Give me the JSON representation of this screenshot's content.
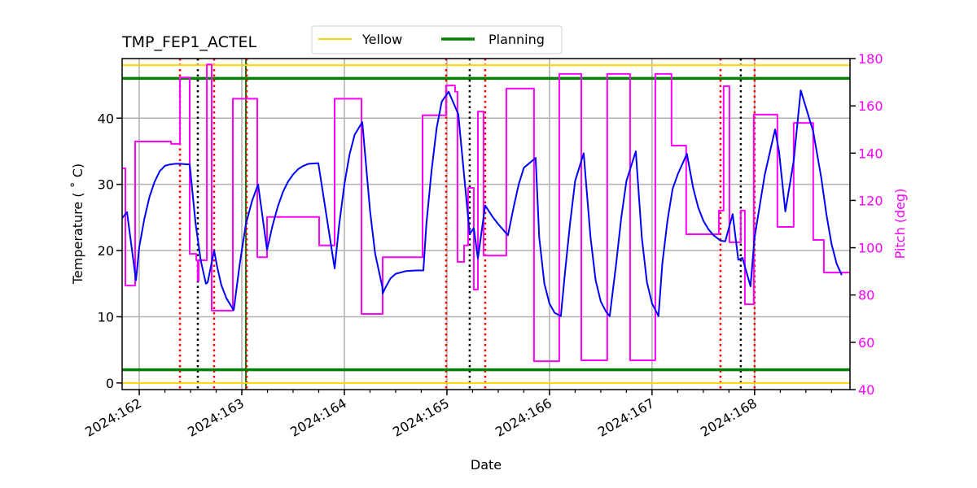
{
  "chart_data": {
    "type": "line",
    "title": "TMP_FEP1_ACTEL",
    "xlabel": "Date",
    "ylabel": "Temperature ($^\\circ$C)",
    "ylabel_display": "Temperature ( ˚ C)",
    "y2label": "Pitch (deg)",
    "xlim": [
      161.833,
      168.93
    ],
    "ylim": [
      -1,
      49
    ],
    "y2lim": [
      40,
      180
    ],
    "x_ticks": [
      {
        "value": 162,
        "label": "2024:162"
      },
      {
        "value": 163,
        "label": "2024:163"
      },
      {
        "value": 164,
        "label": "2024:164"
      },
      {
        "value": 165,
        "label": "2024:165"
      },
      {
        "value": 166,
        "label": "2024:166"
      },
      {
        "value": 167,
        "label": "2024:167"
      },
      {
        "value": 168,
        "label": "2024:168"
      }
    ],
    "x_minor_step": 0.25,
    "y_ticks": [
      0,
      10,
      20,
      30,
      40
    ],
    "y2_ticks": [
      40,
      60,
      80,
      100,
      120,
      140,
      160,
      180
    ],
    "grid": true,
    "legend": {
      "placement": "top-center",
      "entries": [
        {
          "label": "Yellow",
          "color": "#ffd700"
        },
        {
          "label": "Planning",
          "color": "#008000"
        }
      ]
    },
    "limits": {
      "yellow": [
        0,
        48
      ],
      "planning": [
        2,
        46
      ]
    },
    "vlines": {
      "red_dotted": [
        162.397,
        162.73,
        163.048,
        164.992,
        165.373,
        167.667,
        168.0
      ],
      "black_dotted": [
        162.571,
        165.222,
        167.865
      ],
      "green_solid": [
        163.04
      ]
    },
    "series": [
      {
        "name": "Temperature",
        "axis": "left",
        "color": "#0000ff",
        "x": [
          161.833,
          161.881,
          161.968,
          162.0,
          162.05,
          162.1,
          162.15,
          162.2,
          162.25,
          162.3,
          162.35,
          162.397,
          162.492,
          162.55,
          162.6,
          162.65,
          162.667,
          162.73,
          162.76,
          162.8,
          162.85,
          162.92,
          162.921,
          162.98,
          163.04,
          163.1,
          163.159,
          163.246,
          163.3,
          163.35,
          163.4,
          163.45,
          163.5,
          163.55,
          163.6,
          163.65,
          163.746,
          163.905,
          163.95,
          164.0,
          164.05,
          164.1,
          164.175,
          164.25,
          164.3,
          164.37,
          164.373,
          164.4,
          164.45,
          164.5,
          164.6,
          164.7,
          164.77,
          164.8,
          164.85,
          164.9,
          164.95,
          165.016,
          165.111,
          165.222,
          165.262,
          165.302,
          165.373,
          165.45,
          165.5,
          165.595,
          165.65,
          165.7,
          165.75,
          165.865,
          165.9,
          165.95,
          166.0,
          166.05,
          166.111,
          166.15,
          166.2,
          166.25,
          166.333,
          166.4,
          166.45,
          166.5,
          166.55,
          166.587,
          166.65,
          166.7,
          166.75,
          166.841,
          166.9,
          166.95,
          167.0,
          167.05,
          167.063,
          167.1,
          167.15,
          167.2,
          167.25,
          167.34,
          167.4,
          167.45,
          167.5,
          167.55,
          167.6,
          167.65,
          167.667,
          167.714,
          167.786,
          167.841,
          167.881,
          167.96,
          168.0,
          168.1,
          168.2,
          168.238,
          168.3,
          168.381,
          168.45,
          168.571,
          168.65,
          168.7,
          168.75,
          168.8,
          168.85,
          168.93
        ],
        "y": [
          24.9,
          25.8,
          15.5,
          20.5,
          24.8,
          28.1,
          30.4,
          32.0,
          32.8,
          33.0,
          33.1,
          33.1,
          33.0,
          24.0,
          18.5,
          15.0,
          15.2,
          20.0,
          17.5,
          14.8,
          12.8,
          11.0,
          11.0,
          18.0,
          24.0,
          27.5,
          30.0,
          20.1,
          23.8,
          26.6,
          28.8,
          30.4,
          31.5,
          32.3,
          32.8,
          33.1,
          33.2,
          17.3,
          24.0,
          30.0,
          34.5,
          37.5,
          39.4,
          26.0,
          19.5,
          14.5,
          13.5,
          14.4,
          15.8,
          16.5,
          16.9,
          17.0,
          17.0,
          24.0,
          32.0,
          38.5,
          42.5,
          44.0,
          40.6,
          22.5,
          23.4,
          18.8,
          26.8,
          25.0,
          24.0,
          22.3,
          26.5,
          30.0,
          32.5,
          34.0,
          22.0,
          15.0,
          12.0,
          10.6,
          10.1,
          16.5,
          24.0,
          30.5,
          34.7,
          22.0,
          15.5,
          12.3,
          10.8,
          10.1,
          18.0,
          25.0,
          30.5,
          35.0,
          22.0,
          15.2,
          12.0,
          10.5,
          10.1,
          18.0,
          24.5,
          29.3,
          31.5,
          34.6,
          29.5,
          26.5,
          24.5,
          23.2,
          22.3,
          21.7,
          21.5,
          21.4,
          25.5,
          18.6,
          18.9,
          14.6,
          22.0,
          31.5,
          38.3,
          35.0,
          25.9,
          33.5,
          44.2,
          38.0,
          31.0,
          25.5,
          21.0,
          18.0,
          16.3
        ]
      },
      {
        "name": "Pitch",
        "axis": "right",
        "color": "#ff00ff",
        "x": [
          161.833,
          161.865,
          161.865,
          161.96,
          161.96,
          162.31,
          162.31,
          162.397,
          162.397,
          162.492,
          162.492,
          162.556,
          162.556,
          162.57,
          162.57,
          162.579,
          162.579,
          162.659,
          162.659,
          162.706,
          162.706,
          162.913,
          162.913,
          163.151,
          163.151,
          163.246,
          163.246,
          163.754,
          163.754,
          163.905,
          163.905,
          164.167,
          164.167,
          164.373,
          164.373,
          164.762,
          164.762,
          164.992,
          164.992,
          165.079,
          165.079,
          165.103,
          165.103,
          165.167,
          165.167,
          165.206,
          165.206,
          165.262,
          165.262,
          165.302,
          165.302,
          165.357,
          165.357,
          165.579,
          165.579,
          165.849,
          165.849,
          166.095,
          166.095,
          166.31,
          166.31,
          166.563,
          166.563,
          166.786,
          166.786,
          167.032,
          167.032,
          167.19,
          167.19,
          167.333,
          167.333,
          167.651,
          167.651,
          167.698,
          167.698,
          167.754,
          167.754,
          167.865,
          167.865,
          167.905,
          167.905,
          167.992,
          167.992,
          168.222,
          168.222,
          168.381,
          168.381,
          168.571,
          168.571,
          168.675,
          168.675,
          168.93
        ],
        "y": [
          133.6,
          133.6,
          84.0,
          84.0,
          144.9,
          144.9,
          143.9,
          143.9,
          172.0,
          172.0,
          97.4,
          97.4,
          94.7,
          94.7,
          86.0,
          86.0,
          94.7,
          94.7,
          177.5,
          177.5,
          73.4,
          73.4,
          163.0,
          163.0,
          96.0,
          96.0,
          113.0,
          113.0,
          101.0,
          101.0,
          163.0,
          163.0,
          72.0,
          72.0,
          96.0,
          96.0,
          156.0,
          156.0,
          168.6,
          168.6,
          166.0,
          166.0,
          94.0,
          94.0,
          101.0,
          101.0,
          125.3,
          125.3,
          82.3,
          82.3,
          157.6,
          157.6,
          96.7,
          96.7,
          167.3,
          167.3,
          52.0,
          52.0,
          173.5,
          173.5,
          52.4,
          52.4,
          173.5,
          173.5,
          52.4,
          52.4,
          173.5,
          173.5,
          143.2,
          143.2,
          105.7,
          105.7,
          115.7,
          115.7,
          168.3,
          168.3,
          102.3,
          102.3,
          115.7,
          115.7,
          76.1,
          76.1,
          156.3,
          156.3,
          108.8,
          108.8,
          152.8,
          152.8,
          103.3,
          103.3,
          89.5,
          89.5
        ]
      }
    ]
  }
}
